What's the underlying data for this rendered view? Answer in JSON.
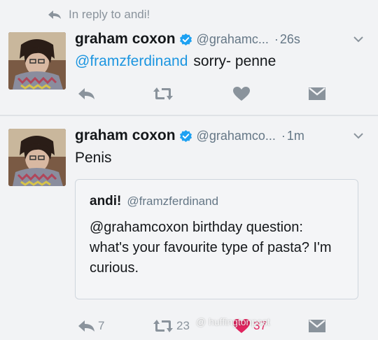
{
  "reply_context": {
    "text": "In reply to andi!"
  },
  "tweets": [
    {
      "name": "graham coxon",
      "handle": "@grahamc...",
      "time": "26s",
      "mention": "@framzferdinand",
      "text": "sorry- penne",
      "actions": {
        "reply": "",
        "retweet": "",
        "like": "",
        "dm": ""
      }
    },
    {
      "name": "graham coxon",
      "handle": "@grahamco...",
      "time": "1m",
      "text": "Penis",
      "quote": {
        "name": "andi!",
        "handle": "@framzferdinand",
        "text": "@grahamcoxon birthday question: what's your favourite type of pasta? I'm curious."
      },
      "actions": {
        "reply": "7",
        "retweet": "23",
        "like": "37",
        "dm": ""
      }
    }
  ],
  "watermark": "@ huffingtonpost",
  "colors": {
    "link": "#1b95e0",
    "verified": "#1da1f2",
    "like": "#e0245e",
    "icon": "#8a939c"
  },
  "icons": [
    "reply-icon",
    "retweet-icon",
    "heart-icon",
    "direct-message-icon",
    "verified-icon",
    "chevron-down-icon"
  ]
}
